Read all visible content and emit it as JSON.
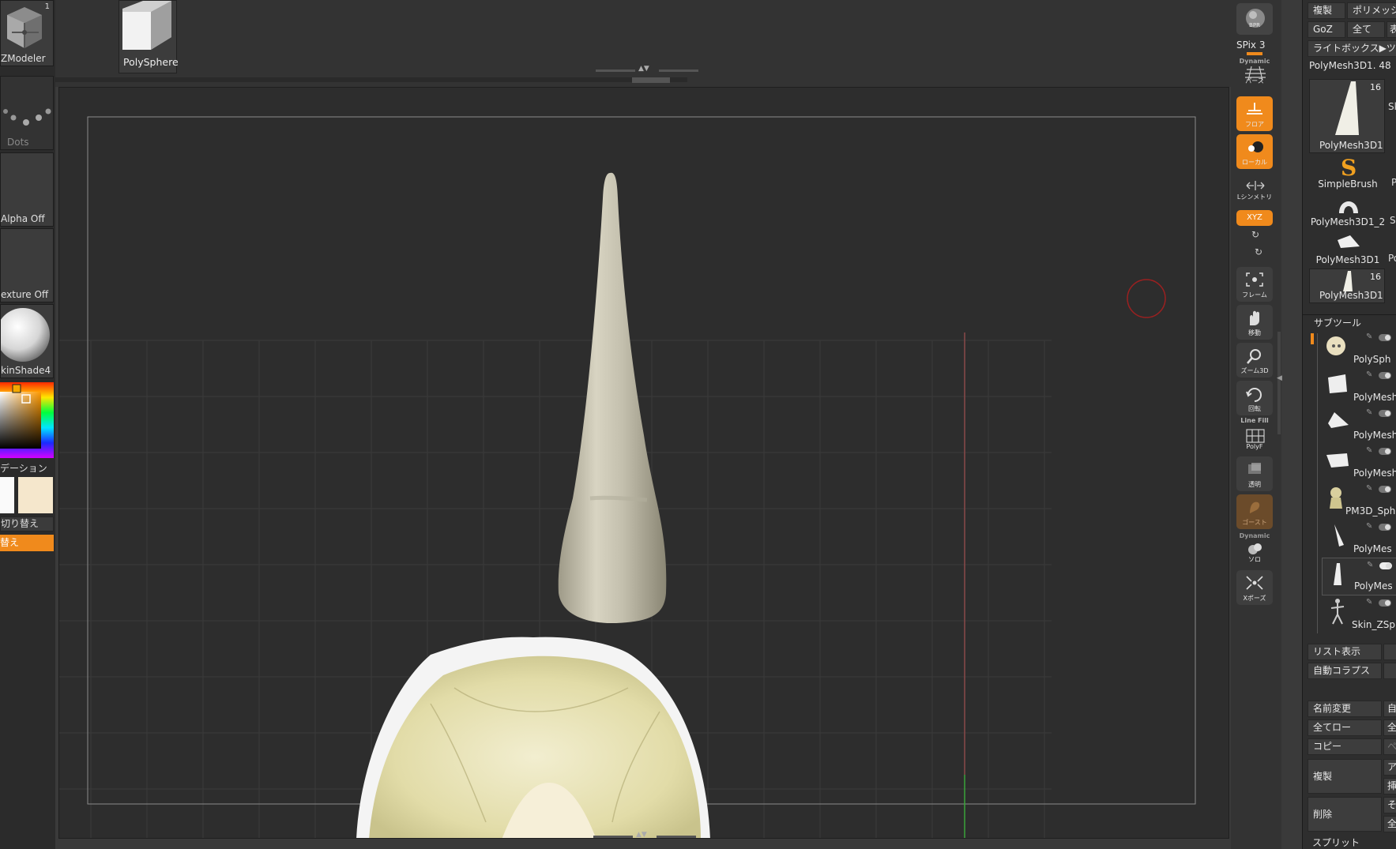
{
  "left_panel": {
    "zmodeler": {
      "label": "ZModeler",
      "count": "1"
    },
    "dots": {
      "label": "Dots"
    },
    "alpha": {
      "label": "Alpha Off"
    },
    "texture": {
      "label": "exture Off"
    },
    "material": {
      "label": "kinShade4"
    },
    "gradation_label": "デーション",
    "switch_label": "切り替え",
    "swap_label": "替え"
  },
  "top_bar": {
    "current_tool": "PolySphere"
  },
  "right_toolbar": {
    "bpr": "BPR",
    "spix": "SPix 3",
    "dynamic": "Dynamic",
    "perspective": "パース",
    "floor": "フロア",
    "local": "ローカル",
    "symmetry": "Lシンメトリ",
    "xyz": "XYZ",
    "frame": "フレーム",
    "move": "移動",
    "zoom3d": "ズーム3D",
    "rotate": "回転",
    "linefill": "Line Fill",
    "polyf": "PolyF",
    "transparent": "透明",
    "ghost": "ゴースト",
    "dynamic2": "Dynamic",
    "solo": "ソロ",
    "xpose": "Xポーズ"
  },
  "right_panel": {
    "buttons_top": [
      "複製",
      "ポリメッシ",
      "GoZ",
      "全て",
      "表",
      "ライトボックス▶ツ"
    ],
    "tool_name": "PolyMesh3D1. 48",
    "current_tool_thumb": {
      "label": "PolyMesh3D1",
      "count": "16",
      "side": "Sk"
    },
    "tools": [
      {
        "label": "SimpleBrush",
        "side": "P"
      },
      {
        "label": "PolyMesh3D1_2",
        "side": "Sk"
      },
      {
        "label": "PolyMesh3D1",
        "side": "Po"
      },
      {
        "label": "PolyMesh3D1",
        "count": "16"
      }
    ],
    "subtool_header": "サブツール",
    "subtools": [
      "PolySph",
      "PolyMesh",
      "PolyMesh",
      "PolyMesh",
      "PM3D_Sph",
      "PolyMes",
      "PolyMes",
      "Skin_ZSp"
    ],
    "list_view": "リスト表示",
    "auto_collapse": "自動コラプス",
    "rename": "名前変更",
    "rename_side": "自",
    "all_low": "全てロー",
    "all_low_side": "全",
    "copy": "コピー",
    "copy_side": "ペ",
    "duplicate": "複製",
    "dup_side_a": "ア",
    "dup_side_b": "挿",
    "delete": "削除",
    "del_side_a": "そ",
    "del_side_b": "全",
    "split": "スプリット"
  },
  "colors": {
    "accent": "#f08a1c",
    "background": "#2d2d2d",
    "panel": "#333333",
    "model_horn": "#c9c4b2",
    "model_head": "#e4dfb2"
  }
}
